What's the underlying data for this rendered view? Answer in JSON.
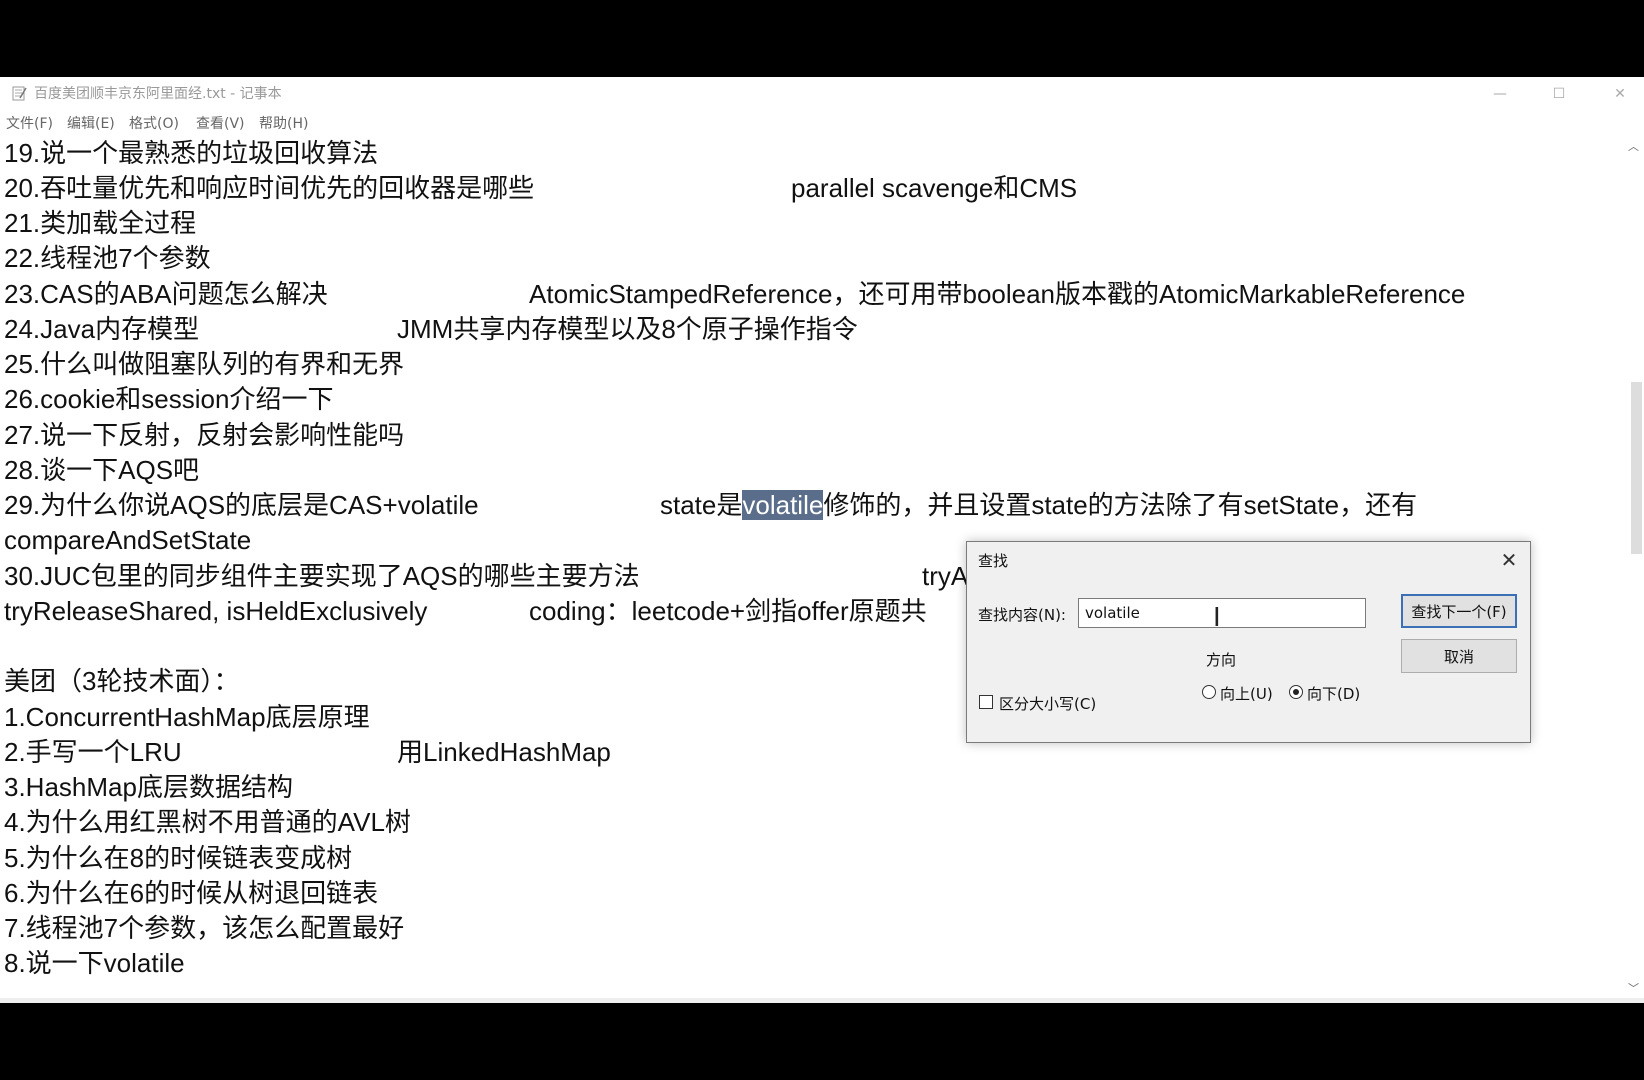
{
  "window": {
    "title": "百度美团顺丰京东阿里面经.txt - 记事本",
    "controls": {
      "minimize": "—",
      "maximize": "☐",
      "close": "✕"
    }
  },
  "menu": [
    "文件(F)",
    "编辑(E)",
    "格式(O)",
    "查看(V)",
    "帮助(H)"
  ],
  "editor": {
    "lines": [
      {
        "a": "19.说一个最熟悉的垃圾回收算法"
      },
      {
        "a": "20.吞吐量优先和响应时间优先的回收器是哪些",
        "b": "parallel scavenge和CMS"
      },
      {
        "a": "21.类加载全过程"
      },
      {
        "a": "22.线程池7个参数"
      },
      {
        "a": "23.CAS的ABA问题怎么解决",
        "b": "AtomicStampedReference，还可用带boolean版本戳的AtomicMarkableReference"
      },
      {
        "a": "24.Java内存模型",
        "b": "JMM共享内存模型以及8个原子操作指令"
      },
      {
        "a": "25.什么叫做阻塞队列的有界和无界"
      },
      {
        "a": "26.cookie和session介绍一下"
      },
      {
        "a": "27.说一下反射，反射会影响性能吗"
      },
      {
        "a": "28.谈一下AQS吧"
      },
      {
        "a": "29.为什么你说AQS的底层是CAS+volatile",
        "b_pre": "state是",
        "b_sel": "volatile",
        "b_post": "修饰的，并且设置state的方法除了有setState，还有"
      },
      {
        "a": "compareAndSetState"
      },
      {
        "a": "30.JUC包里的同步组件主要实现了AQS的哪些主要方法",
        "b": "tryA"
      },
      {
        "a": "tryReleaseShared, isHeldExclusively",
        "b": "coding：leetcode+剑指offer原题共"
      },
      {
        "a": ""
      },
      {
        "a": "美团（3轮技术面）："
      },
      {
        "a": "1.ConcurrentHashMap底层原理"
      },
      {
        "a": "2.手写一个LRU",
        "b": "用LinkedHashMap"
      },
      {
        "a": "3.HashMap底层数据结构"
      },
      {
        "a": "4.为什么用红黑树不用普通的AVL树"
      },
      {
        "a": "5.为什么在8的时候链表变成树"
      },
      {
        "a": "6.为什么在6的时候从树退回链表"
      },
      {
        "a": "7.线程池7个参数，该怎么配置最好"
      },
      {
        "a": "8.说一下volatile"
      }
    ]
  },
  "find_dialog": {
    "title": "查找",
    "find_label": "查找内容(N):",
    "find_value": "volatile",
    "find_next": "查找下一个(F)",
    "cancel": "取消",
    "direction_label": "方向",
    "up": "向上(U)",
    "down": "向下(D)",
    "direction_selected": "down",
    "match_case": "区分大小写(C)",
    "match_case_checked": false
  }
}
